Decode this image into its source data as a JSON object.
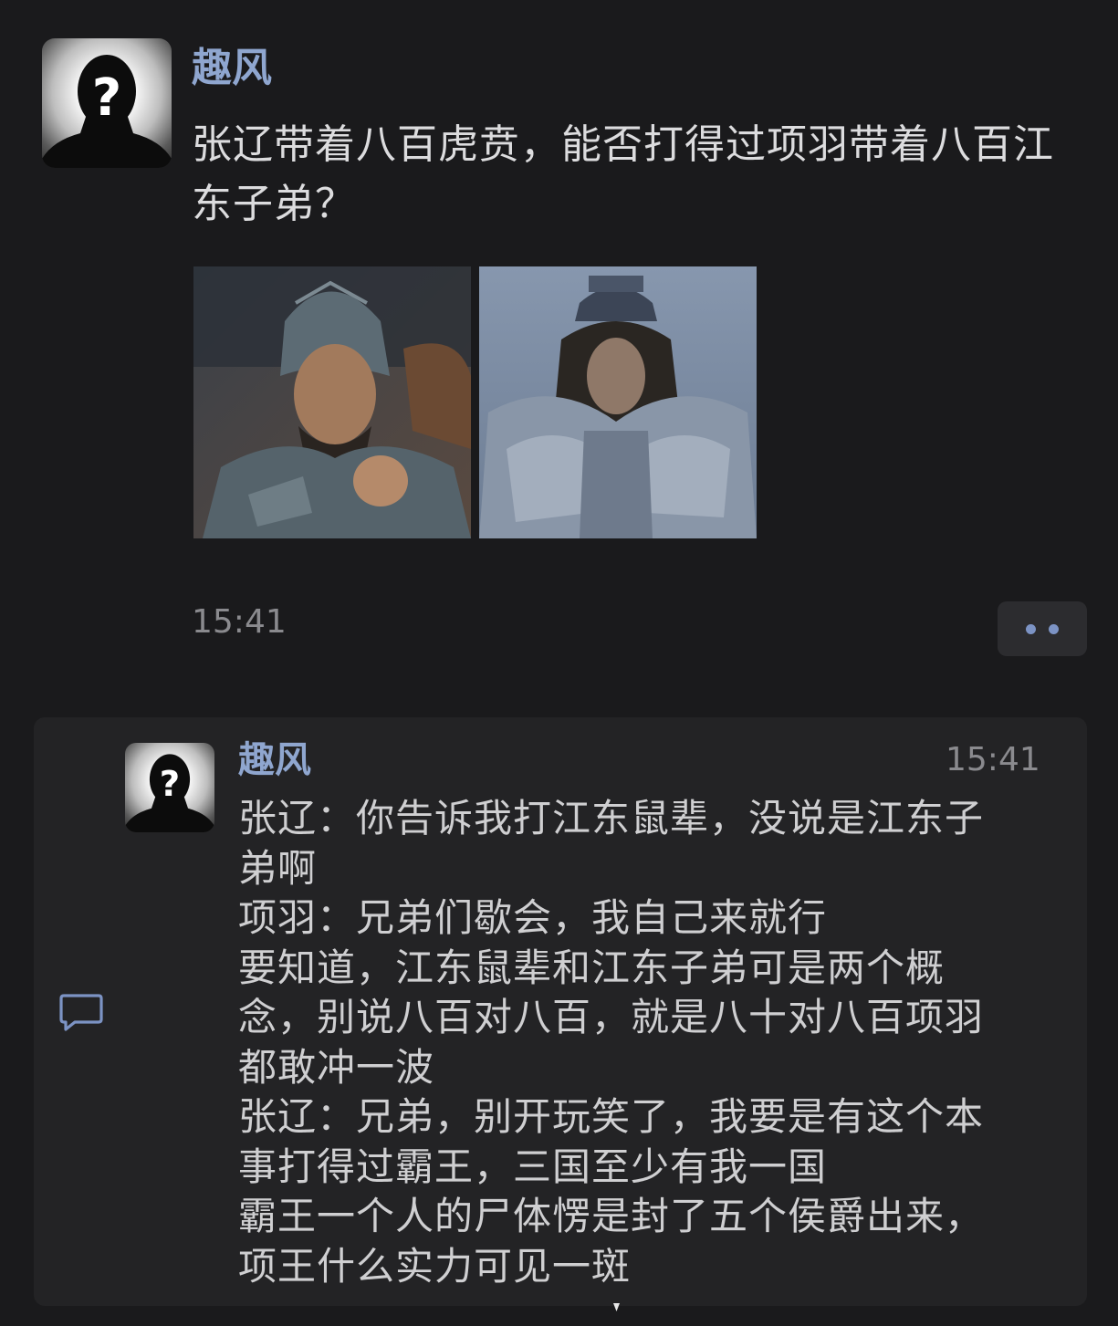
{
  "post": {
    "author": "趣风",
    "text": "张辽带着八百虎贲，能否打得过项羽带着八百江东子弟？",
    "time": "15:41",
    "avatar_icon": "unknown-person-silhouette-icon",
    "images": [
      {
        "subject": "armored-general-with-helmet"
      },
      {
        "subject": "armored-king-with-long-hair"
      }
    ],
    "more_icon": "more-dots-icon"
  },
  "comment": {
    "author": "趣风",
    "time": "15:41",
    "icon": "comment-bubble-icon",
    "lines": [
      "张辽：你告诉我打江东鼠辈，没说是江东子",
      "弟啊",
      "项羽：兄弟们歇会，我自己来就行",
      "要知道，江东鼠辈和江东子弟可是两个概",
      "念，别说八百对八百，就是八十对八百项羽",
      "都敢冲一波",
      "张辽：兄弟，别开玩笑了，我要是有这个本",
      "事打得过霸王，三国至少有我一国",
      "霸王一个人的尸体愣是封了五个侯爵出来，",
      "项王什么实力可见一斑"
    ]
  },
  "colors": {
    "background": "#1a1a1c",
    "card": "#232325",
    "name_accent": "#8fa6cf",
    "text": "#dcdcde",
    "muted": "#8a8a8e"
  }
}
